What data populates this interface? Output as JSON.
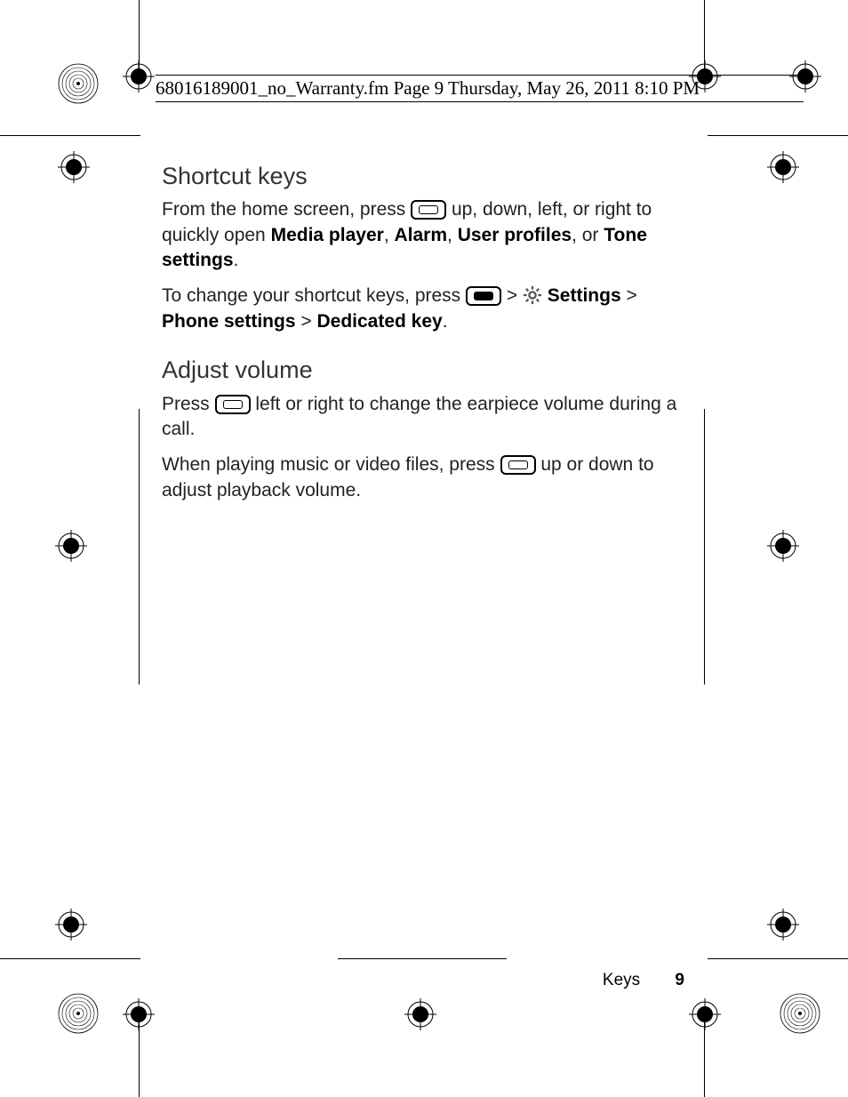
{
  "header": "68016189001_no_Warranty.fm  Page 9  Thursday, May 26, 2011  8:10 PM",
  "section1": {
    "title": "Shortcut keys",
    "p1a": "From the home screen, press ",
    "p1b": " up, down, left, or right to quickly open ",
    "media": "Media player",
    "sep1": ", ",
    "alarm": "Alarm",
    "sep2": ", ",
    "user": "User profiles",
    "sep3": ", or ",
    "tone": "Tone settings",
    "p1end": ".",
    "p2a": "To change your shortcut keys, press ",
    "gt1": " > ",
    "settings": "Settings",
    "gt2": " > ",
    "phone": "Phone settings",
    "gt3": " > ",
    "dedicated": "Dedicated key",
    "p2end": "."
  },
  "section2": {
    "title": "Adjust volume",
    "p1a": "Press ",
    "p1b": " left or right to change the earpiece volume during a call.",
    "p2a": "When playing music or video files, press ",
    "p2b": " up or down to adjust playback volume."
  },
  "footer": {
    "label": "Keys",
    "page": "9"
  }
}
